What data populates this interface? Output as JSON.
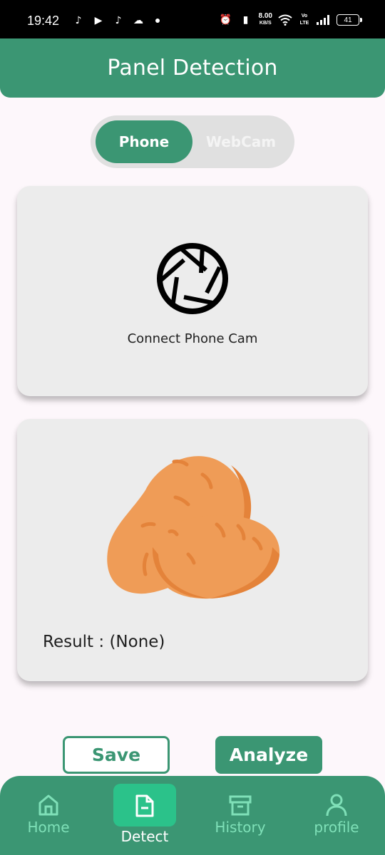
{
  "status_bar": {
    "time": "19:42",
    "speed_value": "8.00",
    "speed_unit": "KB/S",
    "volte": "Vo LTE",
    "battery": "41",
    "icons": [
      "tiktok-icon",
      "youtube-icon",
      "tiktok-icon",
      "weather-icon",
      "dot-icon",
      "alarm-icon",
      "vibrate-icon",
      "wifi-icon",
      "signal-icon",
      "battery-icon"
    ]
  },
  "header": {
    "title": "Panel Detection"
  },
  "toggle": {
    "options": [
      "Phone",
      "WebCam"
    ],
    "selected": "Phone"
  },
  "camera_card": {
    "label": "Connect Phone Cam",
    "icon": "camera-shutter-icon"
  },
  "result_card": {
    "image": "potato-icon",
    "result_text": "Result : (None)"
  },
  "actions": {
    "save_label": "Save",
    "analyze_label": "Analyze"
  },
  "nav": {
    "items": [
      {
        "label": "Home",
        "icon": "home-icon"
      },
      {
        "label": "Detect",
        "icon": "document-icon",
        "active": true
      },
      {
        "label": "History",
        "icon": "archive-icon"
      },
      {
        "label": "profile",
        "icon": "user-icon"
      }
    ]
  },
  "colors": {
    "primary": "#3b9673",
    "active_pill": "#2bc28a",
    "inactive_label": "#7fe0b8",
    "card_bg": "#ececec"
  }
}
